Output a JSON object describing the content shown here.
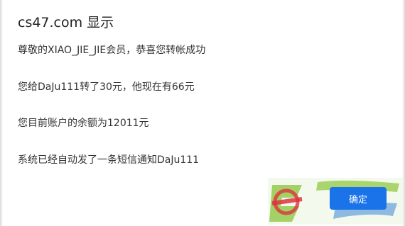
{
  "dialog": {
    "title": "cs47.com 显示",
    "messages": [
      "尊敬的XIAO_JIE_JIE会员，恭喜您转帐成功",
      "您给DaJu111转了30元，他现在有66元",
      "您目前账户的余额为12011元",
      "系统已经自动发了一条短信通知DaJu111"
    ],
    "ok_label": "确定"
  },
  "colors": {
    "accent": "#1a73e8",
    "watermark_green": "#8dc63f",
    "watermark_red": "#d9232d",
    "watermark_blue": "#2b7bd6"
  }
}
